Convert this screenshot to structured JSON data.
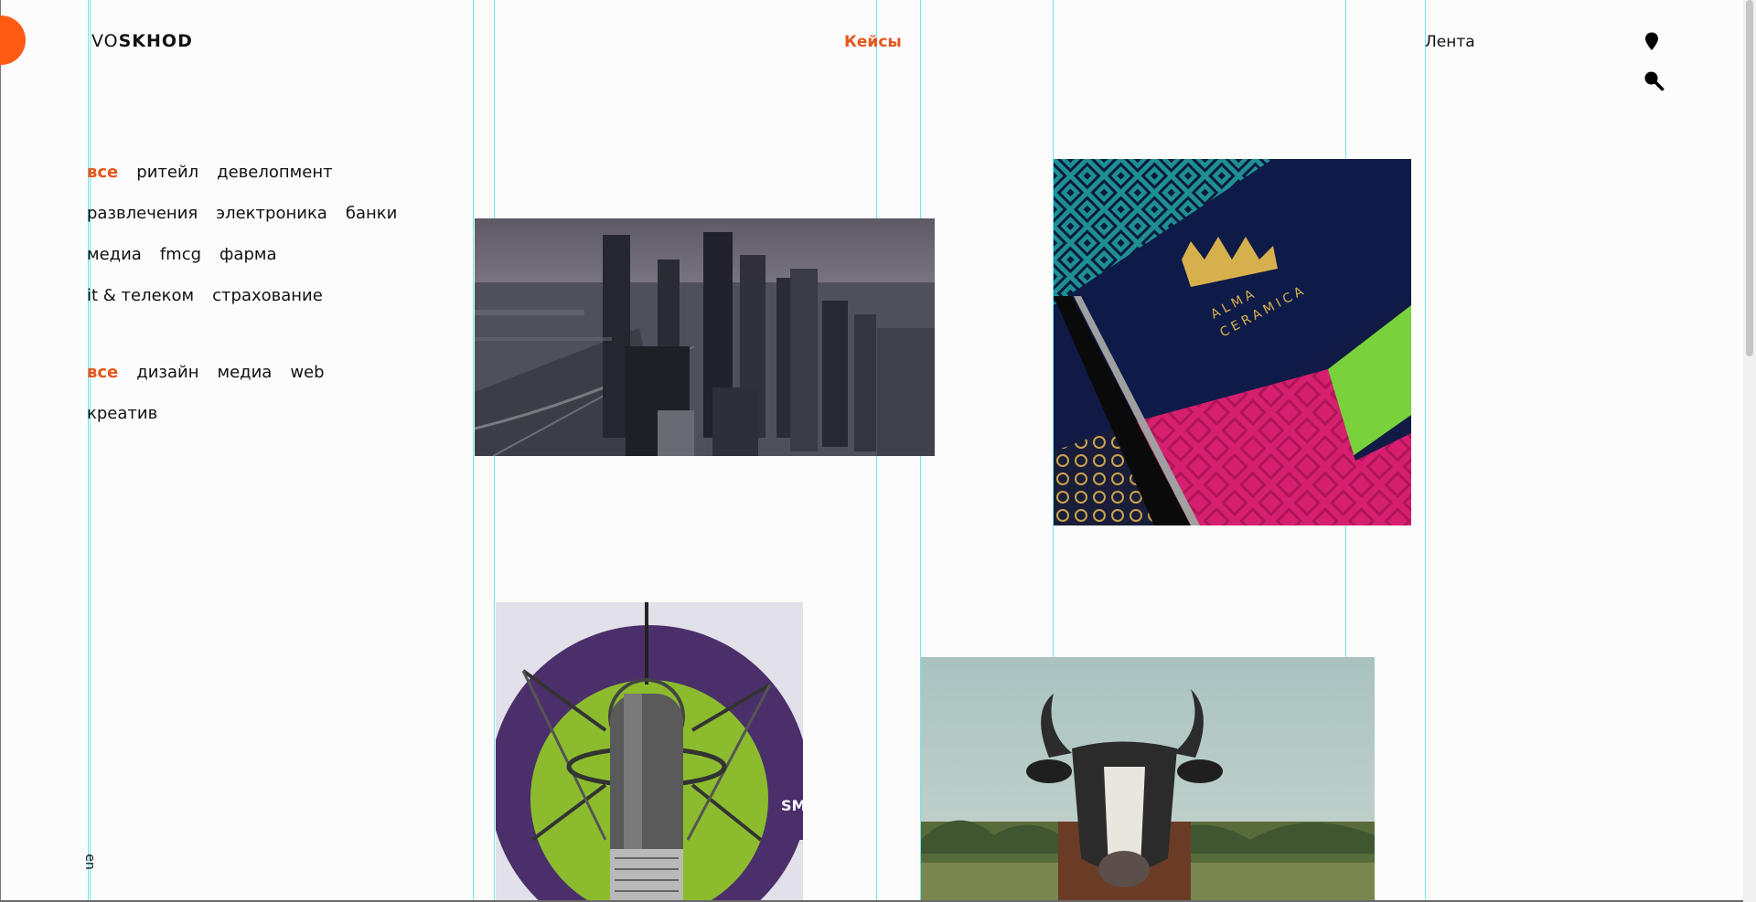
{
  "header": {
    "logo": {
      "thin": "VO",
      "bold": "SKHOD"
    },
    "nav": {
      "cases": "Кейсы",
      "feed": "Лента"
    },
    "icons": {
      "location": "map-pin-icon",
      "search": "search-icon"
    }
  },
  "filters": {
    "industries": [
      "все",
      "ритейл",
      "девелопмент",
      "развлечения",
      "электроника",
      "банки",
      "медиа",
      "fmcg",
      "фарма",
      "it & телеком",
      "страхование"
    ],
    "disciplines": [
      "все",
      "дизайн",
      "медиа",
      "web",
      "креатив"
    ]
  },
  "lang": "en",
  "cards": {
    "alma": {
      "brand_line1": "ALMA",
      "brand_line2": "CERAMICA"
    },
    "mic": {
      "partial_text": "SM"
    }
  },
  "colors": {
    "accent": "#e4571c",
    "guides": "#6fe6ea",
    "blob": "#ff5a14"
  }
}
